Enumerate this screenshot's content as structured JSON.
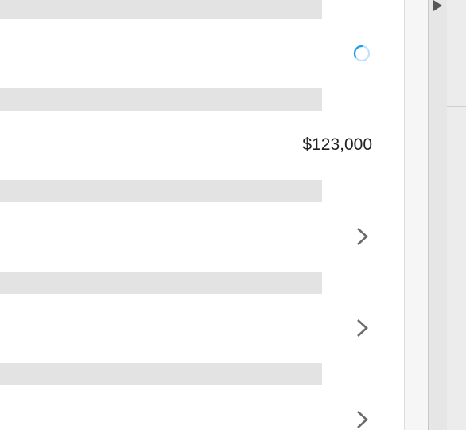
{
  "list": {
    "rows": [
      {
        "kind": "loading",
        "icon": "loading-spinner-icon"
      },
      {
        "kind": "value",
        "value": "$123,000"
      },
      {
        "kind": "link",
        "icon": "chevron-right-icon"
      },
      {
        "kind": "link",
        "icon": "chevron-right-icon"
      },
      {
        "kind": "link",
        "icon": "chevron-right-icon"
      }
    ]
  },
  "side_panel": {
    "expand_icon": "triangle-right-icon"
  },
  "colors": {
    "skeleton": "#e3e3e3",
    "spinner": "#1e9be9",
    "chevron": "#6b6b6b",
    "text": "#222222"
  }
}
